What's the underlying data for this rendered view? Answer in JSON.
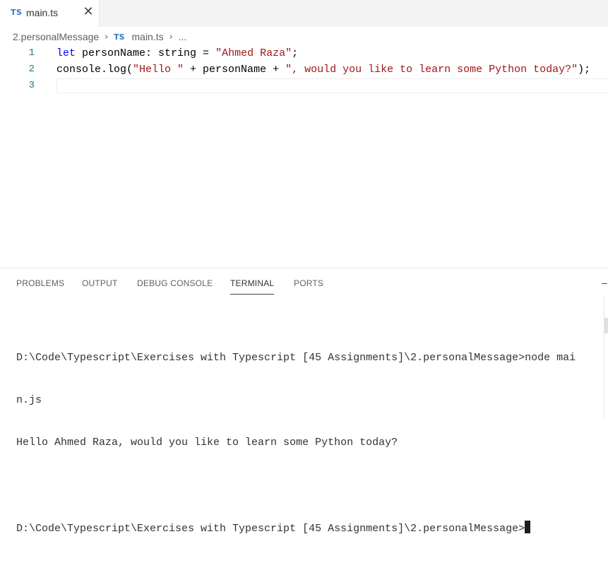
{
  "tab": {
    "badge": "TS",
    "label": "main.ts",
    "close": "✕"
  },
  "breadcrumb": {
    "folder": "2.personalMessage",
    "badge": "TS",
    "file": "main.ts",
    "more": "..."
  },
  "editor": {
    "lines": [
      {
        "num": "1",
        "parts": [
          [
            "kw",
            "let"
          ],
          [
            "plain",
            " personName: string = "
          ],
          [
            "str",
            "\"Ahmed Raza\""
          ],
          [
            "plain",
            ";"
          ]
        ]
      },
      {
        "num": "2",
        "parts": [
          [
            "plain",
            "console.log("
          ],
          [
            "str",
            "\"Hello \""
          ],
          [
            "plain",
            " + personName + "
          ],
          [
            "str",
            "\", would you like to learn some Python today?\""
          ],
          [
            "plain",
            ");"
          ]
        ]
      },
      {
        "num": "3",
        "parts": []
      }
    ]
  },
  "panel": {
    "tabs": [
      "PROBLEMS",
      "OUTPUT",
      "DEBUG CONSOLE",
      "TERMINAL",
      "PORTS"
    ],
    "active_tab": "TERMINAL",
    "dash": "–"
  },
  "terminal": {
    "lines": [
      "D:\\Code\\Typescript\\Exercises with Typescript [45 Assignments]\\2.personalMessage>node mai",
      "n.js",
      "Hello Ahmed Raza, would you like to learn some Python today?",
      "",
      "D:\\Code\\Typescript\\Exercises with Typescript [45 Assignments]\\2.personalMessage>"
    ]
  }
}
